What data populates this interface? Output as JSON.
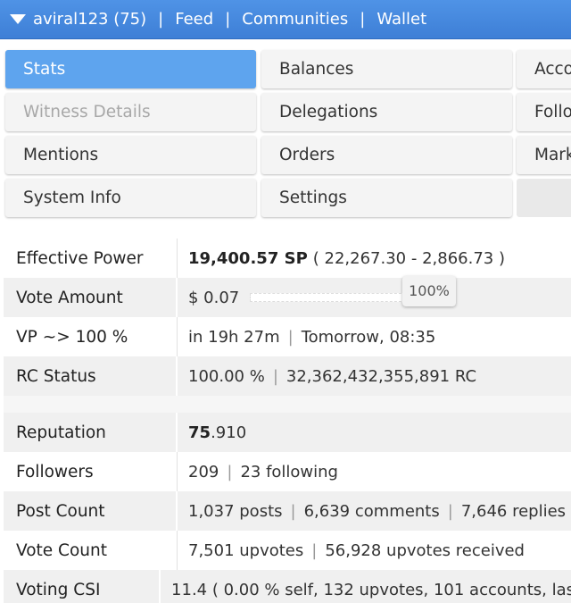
{
  "topbar": {
    "user": "aviral123 (75)",
    "links": [
      "Feed",
      "Communities",
      "Wallet"
    ],
    "separator": "|"
  },
  "menu": {
    "col1": [
      "Stats",
      "Witness Details",
      "Mentions",
      "System Info"
    ],
    "col2": [
      "Balances",
      "Delegations",
      "Orders",
      "Settings"
    ],
    "col3": [
      "Acco",
      "Follo",
      "Mark"
    ]
  },
  "stats": {
    "effective_power": {
      "label": "Effective Power",
      "value": "19,400.57 SP",
      "detail": "( 22,267.30 - 2,866.73 )"
    },
    "vote_amount": {
      "label": "Vote Amount",
      "value": "$ 0.07",
      "percent": "100%",
      "slider_fraction": 1.0
    },
    "vp": {
      "label": "VP ~> 100 %",
      "time": "in 19h 27m",
      "when": "Tomorrow, 08:35"
    },
    "rc": {
      "label": "RC Status",
      "percent": "100.00 %",
      "amount": "32,362,432,355,891 RC"
    },
    "reputation": {
      "label": "Reputation",
      "whole": "75",
      "fraction": ".910"
    },
    "followers": {
      "label": "Followers",
      "count": "209",
      "following": "23 following"
    },
    "post_count": {
      "label": "Post Count",
      "posts": "1,037 posts",
      "comments": "6,639 comments",
      "replies": "7,646 replies"
    },
    "vote_count": {
      "label": "Vote Count",
      "upvotes": "7,501 upvotes",
      "received": "56,928 upvotes received"
    },
    "voting_csi": {
      "label": "Voting CSI",
      "value": "11.4 ( 0.00 % self, 132 upvotes, 101 accounts, las"
    }
  },
  "colors": {
    "topbar": "#4a8de2",
    "active_tab": "#5ea4ee",
    "row_shade": "#f0f0f0"
  }
}
